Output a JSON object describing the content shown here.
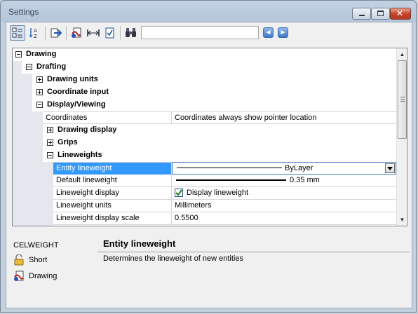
{
  "window": {
    "title": "Settings",
    "close_glyph": "✕"
  },
  "toolbar": {
    "search_value": "",
    "buttons": [
      "categorized-view-icon",
      "alphabetical-view-icon",
      "export-icon",
      "drawing-settings-icon",
      "dimension-icon",
      "checklist-icon",
      "binoculars-find-icon"
    ],
    "nav_prev": "◄",
    "nav_next": "►"
  },
  "tree": {
    "root": "Drawing",
    "drafting": "Drafting",
    "drawing_units": "Drawing units",
    "coordinate_input": "Coordinate input",
    "display_viewing": "Display/Viewing",
    "coordinates_name": "Coordinates",
    "coordinates_value": "Coordinates always show pointer location",
    "drawing_display": "Drawing display",
    "grips": "Grips",
    "lineweights": "Lineweights",
    "props": [
      {
        "name": "Entity lineweight",
        "value": "ByLayer"
      },
      {
        "name": "Default lineweight",
        "value": "0.35 mm"
      },
      {
        "name": "Lineweight display",
        "value": "Display lineweight",
        "checked": true
      },
      {
        "name": "Lineweight units",
        "value": "Millimeters"
      },
      {
        "name": "Lineweight display scale",
        "value": "0.5500"
      }
    ]
  },
  "description": {
    "command": "CELWEIGHT",
    "title": "Entity lineweight",
    "text": "Determines the lineweight of new entities",
    "scope_short": "Short",
    "scope_drawing": "Drawing"
  },
  "colors": {
    "selection": "#3399ff",
    "shade": "#e6e6ef",
    "title_bar": "#b4c6da",
    "close_button": "#c4412a"
  }
}
